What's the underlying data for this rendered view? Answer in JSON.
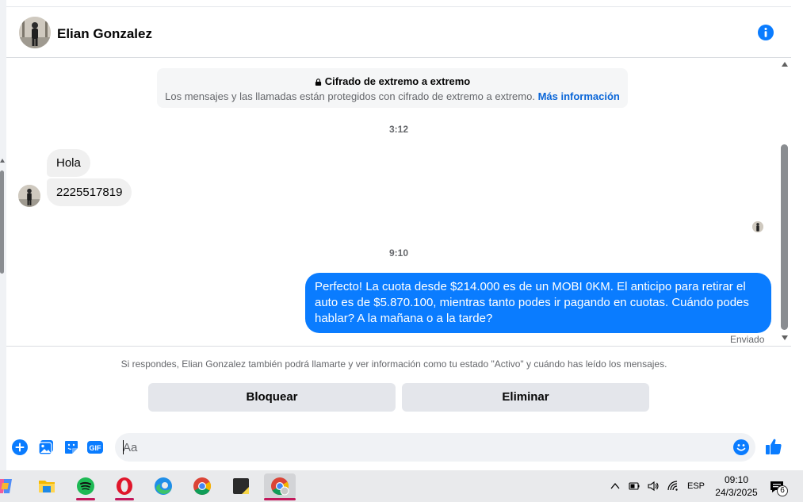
{
  "header": {
    "contact_name": "Elian Gonzalez",
    "info_icon": "info-icon"
  },
  "encryption_notice": {
    "title": "Cifrado de extremo a extremo",
    "description": "Los mensajes y las llamadas están protegidos con cifrado de extremo a extremo.",
    "link": "Más información"
  },
  "messages": [
    {
      "type": "timestamp",
      "text": "3:12"
    },
    {
      "type": "incoming",
      "text": "Hola"
    },
    {
      "type": "incoming",
      "text": "2225517819"
    },
    {
      "type": "timestamp",
      "text": "9:10"
    },
    {
      "type": "outgoing",
      "text": "Perfecto! La cuota desde $214.000 es de un MOBI 0KM. El anticipo para retirar el auto es de $5.870.100, mientras tanto podes ir pagando en cuotas. Cuándo podes hablar? A la mañana o a la tarde?",
      "status": "Enviado"
    }
  ],
  "request_notice": {
    "text": "Si respondes, Elian Gonzalez también podrá llamarte y ver información como tu estado \"Activo\" y cuándo has leído los mensajes.",
    "block_label": "Bloquear",
    "delete_label": "Eliminar"
  },
  "composer": {
    "placeholder": "Aa",
    "icons": [
      "plus-circle-icon",
      "photo-icon",
      "sticker-icon",
      "gif-icon",
      "emoji-icon",
      "thumbs-up-icon"
    ],
    "gif_label": "GIF"
  },
  "taskbar": {
    "apps": [
      "copilot-icon",
      "file-explorer-icon",
      "spotify-icon",
      "opera-icon",
      "edge-icon",
      "chrome-icon",
      "sticky-notes-icon",
      "chrome-profile-icon"
    ],
    "language": "ESP",
    "time": "09:10",
    "date": "24/3/2025",
    "notification_count": "6"
  },
  "colors": {
    "accent": "#0a7cff",
    "link": "#0a66d8",
    "incoming_bubble": "#f0f0f0",
    "button_bg": "#e4e6eb"
  }
}
